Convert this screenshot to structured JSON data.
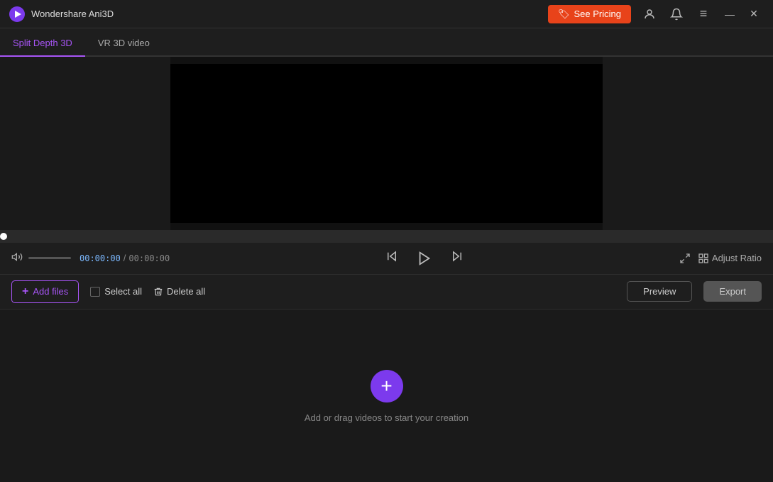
{
  "app": {
    "logo_symbol": "▶",
    "title": "Wondershare Ani3D"
  },
  "header": {
    "see_pricing_label": "See Pricing",
    "see_pricing_icon": "🏷",
    "user_icon": "👤",
    "notification_icon": "🔔",
    "menu_icon": "≡",
    "minimize_icon": "—",
    "close_icon": "✕"
  },
  "tabs": [
    {
      "id": "split-depth-3d",
      "label": "Split Depth 3D",
      "active": true
    },
    {
      "id": "vr-3d-video",
      "label": "VR 3D video",
      "active": false
    }
  ],
  "player": {
    "current_time": "00:00:00",
    "total_time": "00:00:00",
    "time_separator": "/",
    "volume_icon": "🔊",
    "skip_back_icon": "⏮",
    "play_icon": "▶",
    "skip_forward_icon": "⏭",
    "fullscreen_icon": "⛶",
    "adjust_ratio_label": "Adjust Ratio"
  },
  "toolbar": {
    "add_files_label": "Add files",
    "add_files_icon": "+",
    "select_all_label": "Select all",
    "delete_all_label": "Delete all",
    "delete_icon": "🗑",
    "preview_label": "Preview",
    "export_label": "Export"
  },
  "drop_zone": {
    "add_icon": "+",
    "message": "Add or drag videos to start your creation"
  }
}
